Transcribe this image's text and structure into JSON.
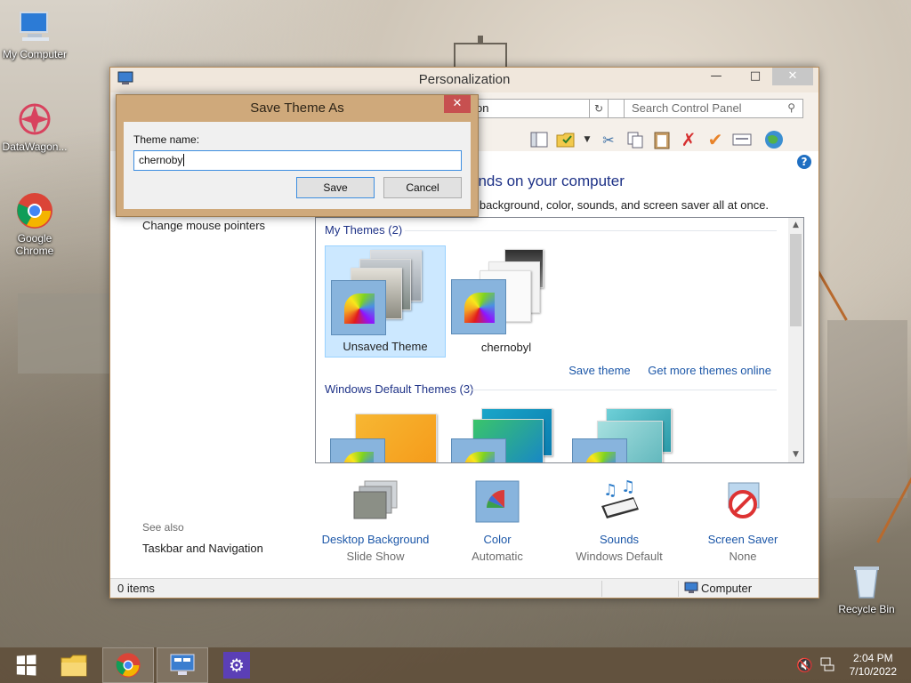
{
  "desktop": {
    "icons": [
      {
        "label": "My Computer"
      },
      {
        "label": "DataWagon..."
      },
      {
        "label": "Google Chrome"
      },
      {
        "label": "Recycle Bin"
      }
    ]
  },
  "window": {
    "title": "Personalization",
    "address_fragment": "on",
    "search_placeholder": "Search Control Panel",
    "heading": "unds on your computer",
    "subheading": "p background, color, sounds, and screen saver all at once.",
    "sidebar_link": "Change mouse pointers",
    "see_also": "See also",
    "see_also_link": "Taskbar and Navigation",
    "my_themes_title": "My Themes (2)",
    "themes": [
      {
        "label": "Unsaved Theme",
        "selected": true
      },
      {
        "label": "chernobyl",
        "selected": false
      }
    ],
    "links": {
      "save_theme": "Save theme",
      "more_themes": "Get more themes online"
    },
    "default_themes_title": "Windows Default Themes (3)",
    "bottom": [
      {
        "label": "Desktop Background",
        "sub": "Slide Show"
      },
      {
        "label": "Color",
        "sub": "Automatic"
      },
      {
        "label": "Sounds",
        "sub": "Windows Default"
      },
      {
        "label": "Screen Saver",
        "sub": "None"
      }
    ],
    "status_left": "0 items",
    "status_right": "Computer"
  },
  "dialog": {
    "title": "Save Theme As",
    "label": "Theme name:",
    "value": "chernoby",
    "save": "Save",
    "cancel": "Cancel"
  },
  "taskbar": {
    "time": "2:04 PM",
    "date": "7/10/2022"
  }
}
